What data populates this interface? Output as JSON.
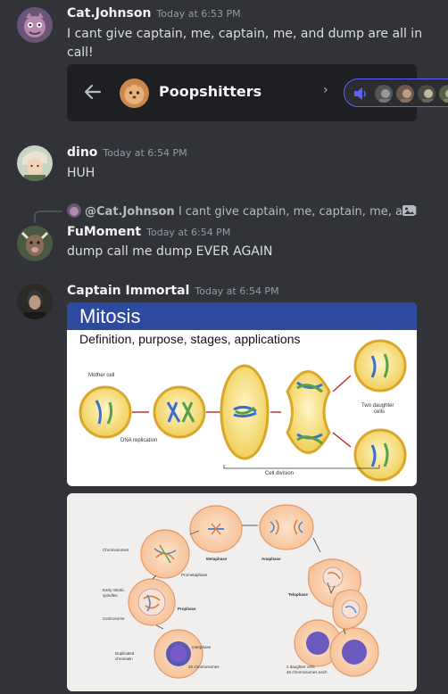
{
  "messages": [
    {
      "username": "Cat.Johnson",
      "timestamp": "Today at 6:53 PM",
      "text": "I cant give captain, me, captain, me, and dump are all in call!"
    },
    {
      "username": "dino",
      "timestamp": "Today at 6:54 PM",
      "text": "HUH"
    },
    {
      "username": "FuMoment",
      "timestamp": "Today at 6:54 PM",
      "text": "dump call me dump EVER AGAIN",
      "reply": {
        "username": "@Cat.Johnson",
        "preview": "I cant give captain, me, captain, me, and du"
      }
    },
    {
      "username": "Captain Immortal",
      "timestamp": "Today at 6:54 PM"
    }
  ],
  "call_embed": {
    "server_name": "Poopshitters",
    "chevron": "›",
    "back_icon": "arrow-left-icon",
    "voice_icon": "speaker-icon",
    "participant_count": 4
  },
  "image1": {
    "title": "Mitosis",
    "subtitle": "Definition, purpose, stages, applications",
    "labels": {
      "mother_cell": "Mother cell",
      "dna_replication": "DNA replication",
      "cell_division": "Cell division",
      "two_daughter": "Two daughter",
      "cells": "cells"
    }
  },
  "image2": {
    "labels": {
      "chromosomes": "Chromosomes",
      "early_spindles": "Early mitotic",
      "spindles": "spindles",
      "centrosome": "Centrosome",
      "duplicated": "Duplicated",
      "chromatin": "chromatin",
      "prometaphase": "Prometaphase",
      "metaphase": "Metaphase",
      "anaphase": "Anaphase",
      "prophase": "Prophase",
      "telophase": "Telophase",
      "interphase": "Interphase",
      "chromosomes46": "46 chromosomes",
      "daughter_cells": "2 daughter cells",
      "daughter_cells2": "46 chromosomes each"
    }
  },
  "colors": {
    "background": "#313338",
    "accent": "#5865f2",
    "embed_bg": "#1e1f22",
    "mitosis_banner": "#2e4a9e"
  }
}
